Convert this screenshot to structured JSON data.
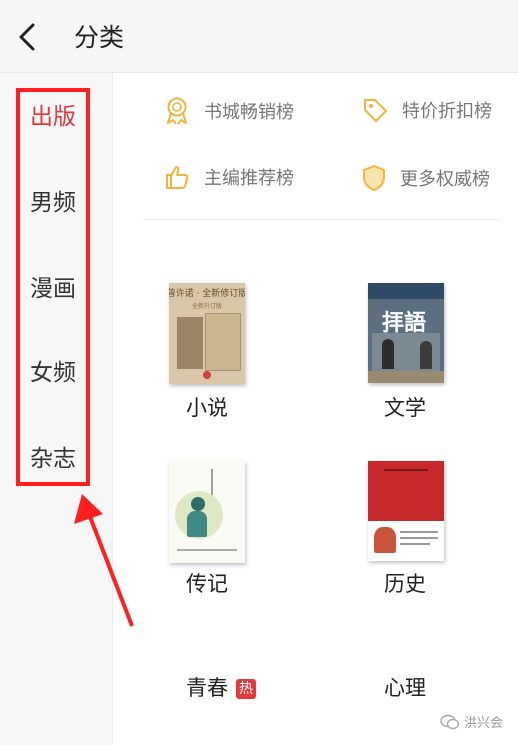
{
  "header": {
    "title": "分类"
  },
  "sidebar": {
    "items": [
      {
        "label": "出版",
        "active": true
      },
      {
        "label": "男频"
      },
      {
        "label": "漫画"
      },
      {
        "label": "女频"
      },
      {
        "label": "杂志"
      }
    ]
  },
  "rankings": [
    {
      "label": "书城畅销榜",
      "icon": "medal-icon"
    },
    {
      "label": "特价折扣榜",
      "icon": "tag-icon"
    },
    {
      "label": "主编推荐榜",
      "icon": "thumbs-up-icon"
    },
    {
      "label": "更多权威榜",
      "icon": "shield-icon"
    }
  ],
  "categories": [
    {
      "label": "小说",
      "cover_text": "曾许诺 · 全新修订版",
      "cover_sub": "全新升订版"
    },
    {
      "label": "文学",
      "cover_text": "拝語"
    },
    {
      "label": "传记"
    },
    {
      "label": "历史"
    },
    {
      "label": "青春",
      "badge": "热"
    },
    {
      "label": "心理"
    }
  ],
  "watermark": {
    "text": "洪兴会"
  },
  "colors": {
    "accent": "#e4393c",
    "highlight": "#ff1f1f",
    "icon": "#f2b43a"
  }
}
